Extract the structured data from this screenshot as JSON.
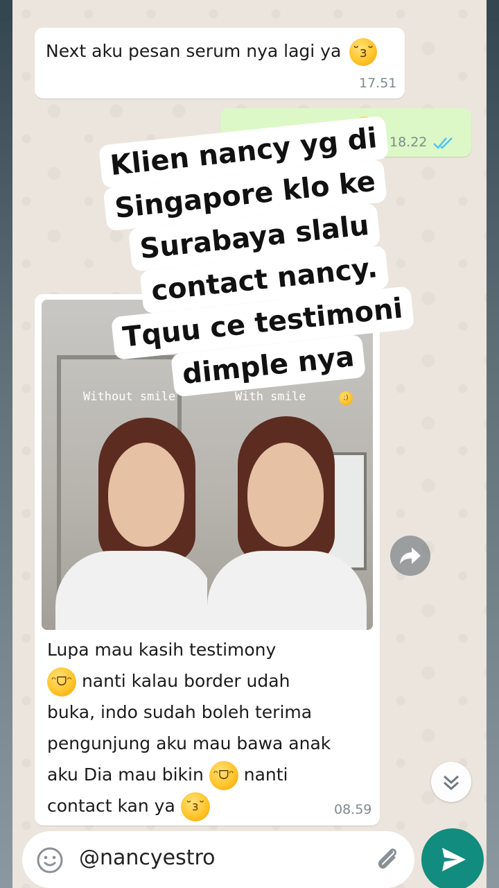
{
  "chat": {
    "messages": [
      {
        "direction": "in",
        "text": "Next aku pesan serum nya lagi ya",
        "emoji": "kissing-heart-emoji",
        "time": "17.51"
      },
      {
        "direction": "out",
        "time": "18.22",
        "read_status": "double-check-read-icon"
      },
      {
        "direction": "in",
        "image": {
          "left_caption": "Without smile",
          "right_caption": "With smile"
        },
        "lines": [
          "Lupa mau kasih testimony",
          "nanti kalau border udah",
          "buka, indo sudah boleh terima",
          "pengunjung aku mau bawa anak",
          "aku Dia mau bikin",
          "nanti",
          "contact kan ya"
        ],
        "time": "08.59"
      }
    ]
  },
  "overlay": {
    "lines": [
      "Klien nancy yg di",
      "Singapore klo ke",
      "Surabaya slalu",
      "contact nancy.",
      "Tquu ce testimoni",
      "dimple nya"
    ]
  },
  "composer": {
    "text": "@nancyestro"
  },
  "colors": {
    "chat_bg": "#ece5dd",
    "outgoing_bubble": "#dcf8c6",
    "incoming_bubble": "#ffffff",
    "send_button": "#128c7e",
    "read_tick": "#4fc3f7"
  }
}
